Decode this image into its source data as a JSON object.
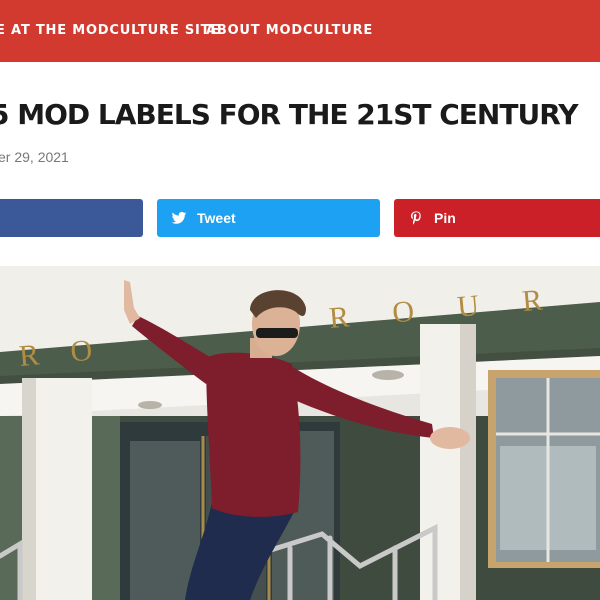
{
  "nav": {
    "link1": "E AT THE MODCULTURE SITE",
    "link2": "ABOUT MODCULTURE"
  },
  "article": {
    "title": "5 MOD LABELS FOR THE 21ST CENTURY",
    "date": "er 29, 2021"
  },
  "share": {
    "twitter_label": "Tweet",
    "pin_label": "Pin"
  },
  "hero": {
    "building_lettering": "R O U R",
    "building_lettering_left": "R O"
  },
  "colors": {
    "nav_bg": "#d23a30",
    "facebook": "#3b5998",
    "twitter": "#1da1f2",
    "pinterest": "#cb2027"
  }
}
